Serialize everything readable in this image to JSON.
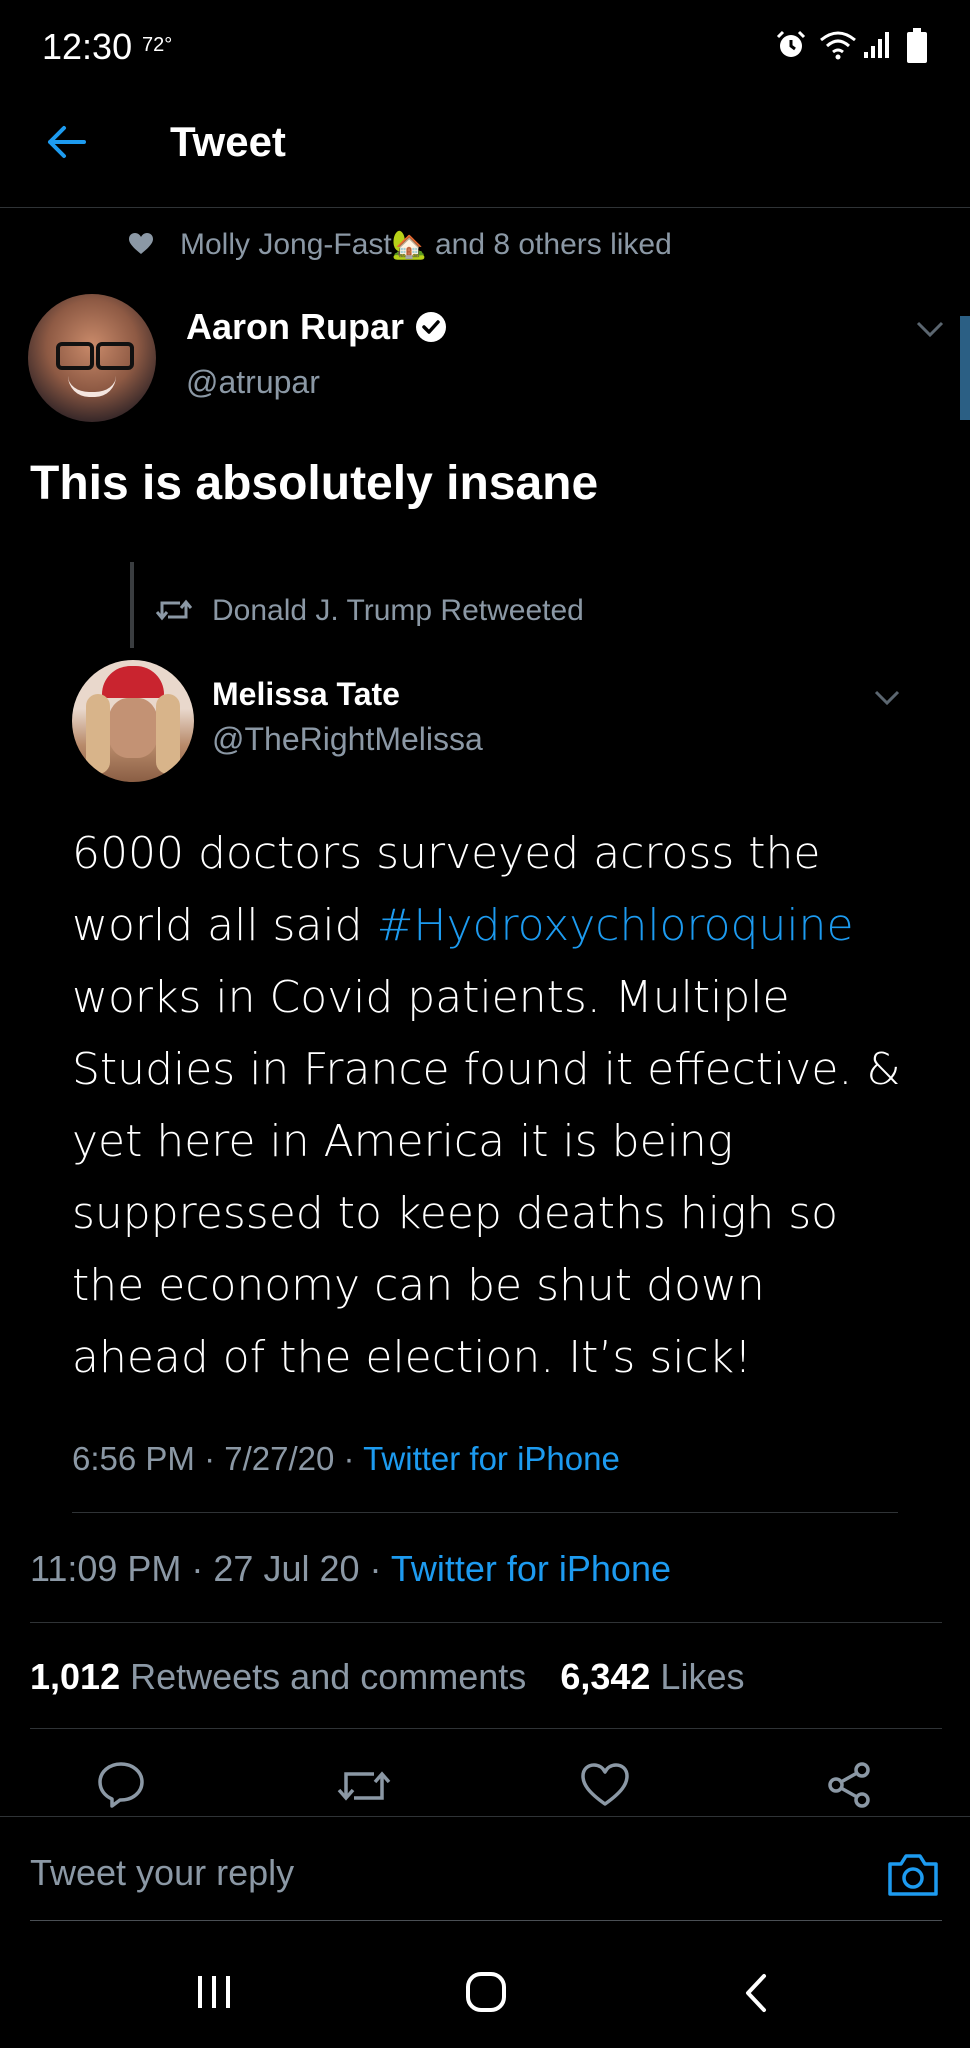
{
  "status_bar": {
    "time": "12:30",
    "temp": "72°"
  },
  "header": {
    "title": "Tweet"
  },
  "social_context": {
    "liked_by": "Molly Jong-Fast",
    "emoji": "🏡",
    "suffix": "and 8 others liked"
  },
  "tweet": {
    "author_name": "Aaron Rupar",
    "author_handle": "@atrupar",
    "text": "This is absolutely insane",
    "timestamp": "11:09 PM · 27 Jul 20 · ",
    "source": "Twitter for iPhone"
  },
  "quoted": {
    "retweeted_by": "Donald J. Trump Retweeted",
    "author_name": "Melissa Tate",
    "author_handle": "@TheRightMelissa",
    "text_before": "6000 doctors surveyed across the world all said ",
    "hashtag": "#Hydroxychloroquine",
    "text_after": " works in Covid patients. Multiple Studies in France found it effective. & yet here in America it is being suppressed to keep deaths high so the economy can be shut down ahead of the election. It’s sick!",
    "timestamp": "6:56 PM · 7/27/20 · ",
    "source": "Twitter for iPhone"
  },
  "stats": {
    "retweets_count": "1,012",
    "retweets_label": "Retweets and comments",
    "likes_count": "6,342",
    "likes_label": "Likes"
  },
  "reply": {
    "placeholder": "Tweet your reply"
  },
  "colors": {
    "accent": "#1d9bf0",
    "secondary_text": "#8b98a5",
    "background": "#000000"
  }
}
